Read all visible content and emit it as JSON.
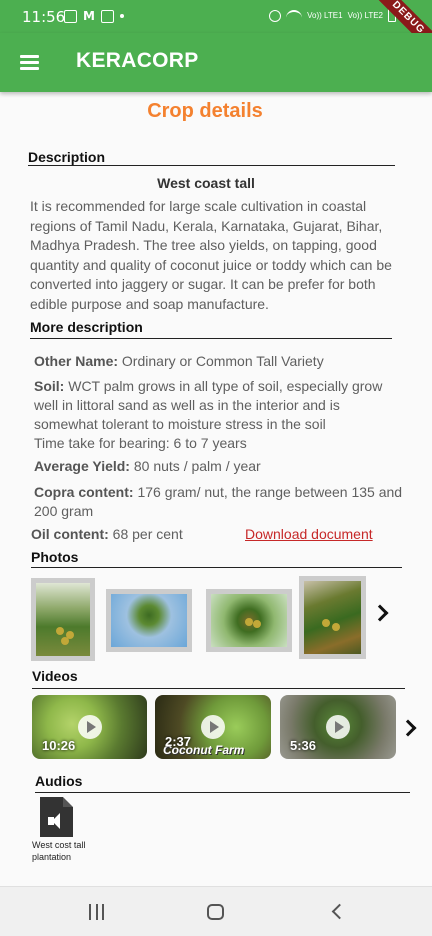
{
  "status_bar": {
    "time": "11:56",
    "m_label": "M",
    "right_label_1": "Vo)) LTE1",
    "right_label_2": "Vo)) LTE2"
  },
  "debug_banner": "DEBUG",
  "app_bar": {
    "title": "KERACORP",
    "color": "#4caf50"
  },
  "page": {
    "title": "Crop details",
    "title_color": "#f4812f"
  },
  "description": {
    "heading": "Description",
    "crop_name": "West coast tall",
    "text": "It is recommended for large scale cultivation in coastal regions of Tamil Nadu, Kerala, Karnataka, Gujarat, Bihar, Madhya Pradesh. The tree also yields, on tapping, good quantity and quality of coconut juice or toddy which can be converted into jaggery or sugar. It can be prefer for both edible purpose and soap manufacture."
  },
  "more_description": {
    "heading": "More description",
    "other_name_label": "Other Name:",
    "other_name_value": "Ordinary or Common Tall Variety",
    "soil_label": "Soil:",
    "soil_value": "WCT palm grows in all type of soil, especially grow well in littoral sand as well as in the interior and is somewhat tolerant to moisture stress in the soil",
    "bearing_text": "Time take for bearing: 6 to 7 years",
    "yield_label": "Average Yield:",
    "yield_value": "80 nuts / palm / year",
    "copra_label": "Copra content:",
    "copra_value": "176 gram/ nut, the range between 135 and 200 gram",
    "oil_label": "Oil content:",
    "oil_value": "68 per cent",
    "download_label": "Download document"
  },
  "photos": {
    "heading": "Photos"
  },
  "videos": {
    "heading": "Videos",
    "items": [
      {
        "duration": "10:26",
        "caption": ""
      },
      {
        "duration": "2:37",
        "caption": "Coconut Farm"
      },
      {
        "duration": "5:36",
        "caption": ""
      }
    ]
  },
  "audios": {
    "heading": "Audios",
    "items": [
      {
        "label": "West cost tall plantation"
      }
    ]
  }
}
